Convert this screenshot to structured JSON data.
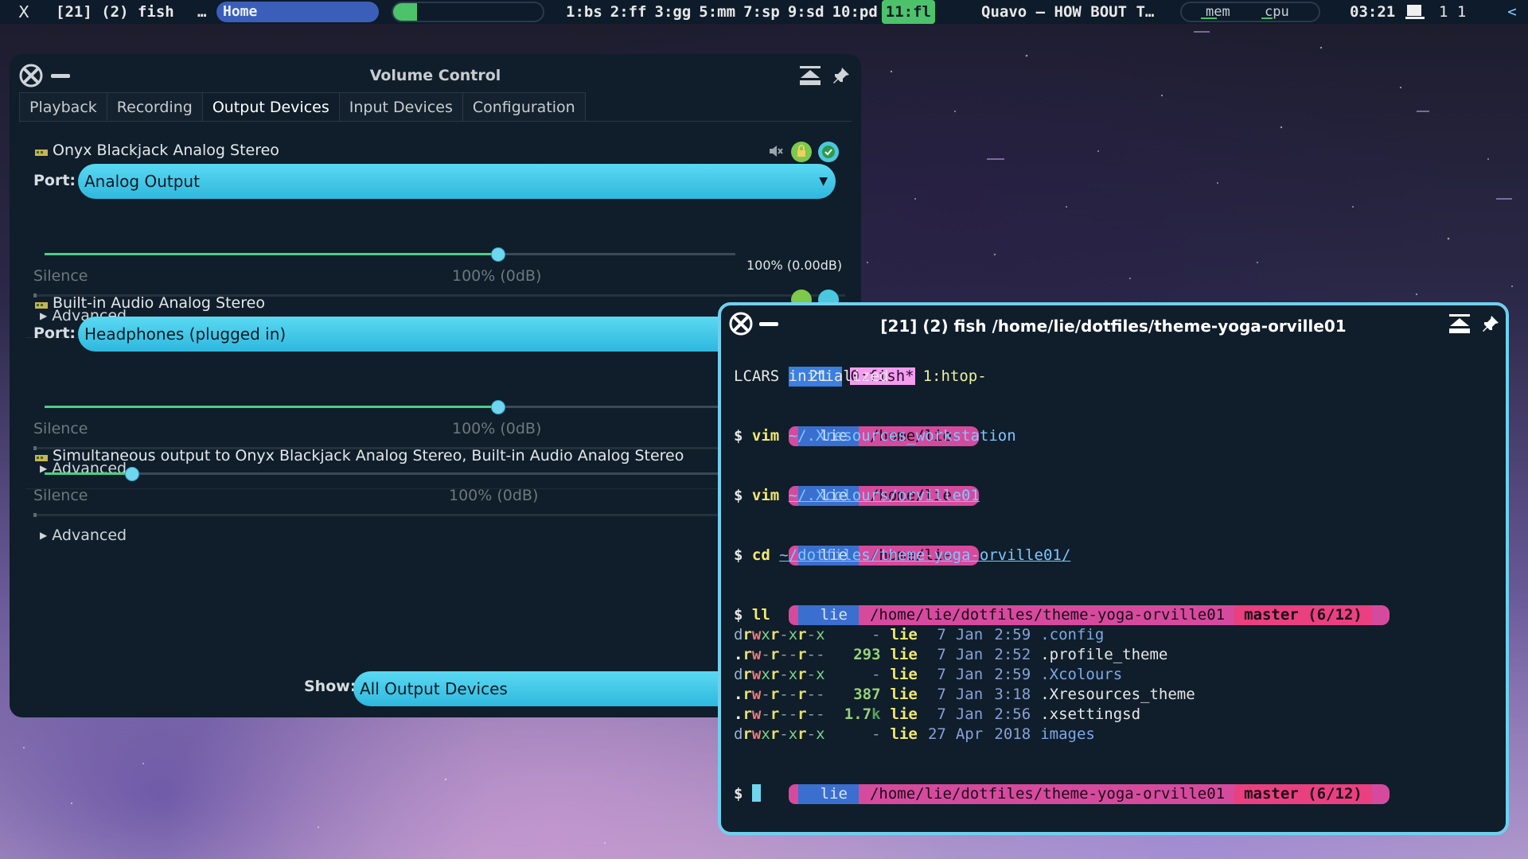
{
  "topbar": {
    "close": "X",
    "title": "[21] (2) fish",
    "ellipsis": "…",
    "home": "Home",
    "progress": 0.16,
    "workspaces": [
      {
        "label": "1:bs",
        "active": false
      },
      {
        "label": "2:ff",
        "active": false
      },
      {
        "label": "3:gg",
        "active": false
      },
      {
        "label": "5:mm",
        "active": false
      },
      {
        "label": "7:sp",
        "active": false
      },
      {
        "label": "9:sd",
        "active": false
      },
      {
        "label": "10:pd",
        "active": false
      },
      {
        "label": "11:fl",
        "active": true
      }
    ],
    "song": "Quavo – HOW BOUT T…",
    "mem": "mem",
    "cpu": "cpu",
    "clock": "03:21",
    "counters": "1 1",
    "back": "<"
  },
  "volume_control": {
    "title": "Volume Control",
    "tabs": [
      "Playback",
      "Recording",
      "Output Devices",
      "Input Devices",
      "Configuration"
    ],
    "active_tab": "Output Devices",
    "port_label": "Port:",
    "silence_label": "Silence",
    "hundred_label": "100% (0dB)",
    "advanced_label": "Advanced",
    "devices": [
      {
        "name": "Onyx Blackjack Analog Stereo",
        "port": "Analog Output",
        "volume_text": "100% (0.00dB)",
        "volume": 0.655
      },
      {
        "name": "Built-in Audio Analog Stereo",
        "port": "Headphones (plugged in)",
        "volume": 0.655
      },
      {
        "name": "Simultaneous output to Onyx Blackjack Analog Stereo, Built-in Audio Analog Stereo",
        "volume": 0.125
      }
    ],
    "show_label": "Show:",
    "show_value": "All Output Devices"
  },
  "terminal": {
    "title": "[21] (2) fish  /home/lie/dotfiles/theme-yoga-orville01",
    "tmux": {
      "session": "21",
      "window0": "0:fish*",
      "window1": "1:htop-"
    },
    "init_line": "LCARS initialized",
    "prompt_user": "lie",
    "home_path": "/home/lie",
    "dotfiles_path": "/home/lie/dotfiles/theme-yoga-orville01",
    "branch": "master (6/12)",
    "dollar": "$",
    "commands": [
      {
        "cmd": "vim",
        "arg": "~/.Xresources_workstation"
      },
      {
        "cmd": "vim",
        "arg": "~/.Xcolours/orville01"
      },
      {
        "cmd": "cd",
        "arg": "~/dotfiles/theme-yoga-orville01/"
      },
      {
        "cmd": "ll",
        "arg": ""
      }
    ],
    "listing": [
      {
        "perm": "drwxr-xr-x",
        "size": "-",
        "owner": "lie",
        "day": "7",
        "month": "Jan",
        "time": "2:59",
        "name": ".config",
        "dir": true
      },
      {
        "perm": ".rw-r--r--",
        "size": "293",
        "owner": "lie",
        "day": "7",
        "month": "Jan",
        "time": "2:52",
        "name": ".profile_theme",
        "dir": false
      },
      {
        "perm": "drwxr-xr-x",
        "size": "-",
        "owner": "lie",
        "day": "7",
        "month": "Jan",
        "time": "2:59",
        "name": ".Xcolours",
        "dir": true
      },
      {
        "perm": ".rw-r--r--",
        "size": "387",
        "owner": "lie",
        "day": "7",
        "month": "Jan",
        "time": "3:18",
        "name": ".Xresources_theme",
        "dir": false
      },
      {
        "perm": ".rw-r--r--",
        "size": "1.7k",
        "owner": "lie",
        "day": "7",
        "month": "Jan",
        "time": "2:56",
        "name": ".xsettingsd",
        "dir": false
      },
      {
        "perm": "drwxr-xr-x",
        "size": "-",
        "owner": "lie",
        "day": "27",
        "month": "Apr",
        "time": "2018",
        "name": "images",
        "dir": true
      }
    ]
  },
  "colors": {
    "accent": "#6fd0ee",
    "bar_bg": "#0d1b2a",
    "green": "#4cc36a",
    "tmux_blue": "#3b7fe0",
    "prompt_pink": "#d64a9e",
    "branch_red": "#ea4080"
  }
}
